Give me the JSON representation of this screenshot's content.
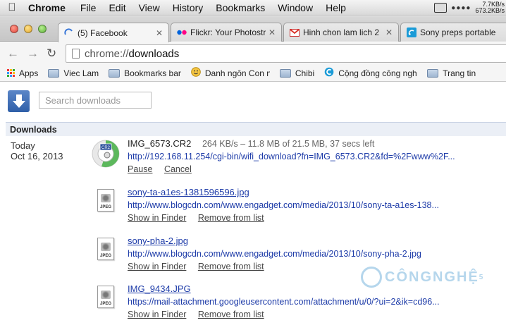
{
  "menubar": {
    "app_name": "Chrome",
    "items": [
      "File",
      "Edit",
      "View",
      "History",
      "Bookmarks",
      "Window",
      "Help"
    ],
    "net_up": "7.7KB/s",
    "net_down": "673.2KB/s"
  },
  "tabs": [
    {
      "label": "(5) Facebook",
      "icon": "loading-spinner-icon"
    },
    {
      "label": "Flickr: Your Photostr",
      "icon": "flickr-icon"
    },
    {
      "label": "Hinh chon lam lich 2",
      "icon": "gmail-icon"
    },
    {
      "label": "Sony preps portable",
      "icon": "engadget-icon"
    }
  ],
  "omnibox": {
    "scheme": "chrome://",
    "host": "downloads"
  },
  "bookmarks": [
    {
      "label": "Apps",
      "icon": "apps-grid-icon"
    },
    {
      "label": "Viec Lam",
      "icon": "folder-icon"
    },
    {
      "label": "Bookmarks bar",
      "icon": "folder-icon"
    },
    {
      "label": "Danh ngôn Con người",
      "icon": "smiley-icon"
    },
    {
      "label": "Chibi",
      "icon": "folder-icon"
    },
    {
      "label": "Cộng đồng công nghệ",
      "icon": "site-c-icon"
    },
    {
      "label": "Trang tin",
      "icon": "folder-icon"
    }
  ],
  "search": {
    "placeholder": "Search downloads"
  },
  "section_title": "Downloads",
  "date_group": {
    "day": "Today",
    "date": "Oct 16, 2013"
  },
  "downloads": [
    {
      "name": "IMG_6573.CR2",
      "status": "264 KB/s – 11.8 MB of 21.5 MB, 37 secs left",
      "url": "http://192.168.11.254/cgi-bin/wifi_download?fn=IMG_6573.CR2&fd=%2Fwww%2F...",
      "actions": [
        "Pause",
        "Cancel"
      ],
      "badge": "CR2",
      "progress": 0.55
    },
    {
      "name": "sony-ta-a1es-1381596596.jpg",
      "url": "http://www.blogcdn.com/www.engadget.com/media/2013/10/sony-ta-a1es-138...",
      "actions": [
        "Show in Finder",
        "Remove from list"
      ],
      "badge": "JPEG"
    },
    {
      "name": "sony-pha-2.jpg",
      "url": "http://www.blogcdn.com/www.engadget.com/media/2013/10/sony-pha-2.jpg",
      "actions": [
        "Show in Finder",
        "Remove from list"
      ],
      "badge": "JPEG"
    },
    {
      "name": "IMG_9434.JPG",
      "url": "https://mail-attachment.googleusercontent.com/attachment/u/0/?ui=2&ik=cd96...",
      "actions": [
        "Show in Finder",
        "Remove from list"
      ],
      "badge": "JPEG"
    }
  ],
  "watermark": {
    "text": "CÔNGNGHỆ",
    "superscript": "5"
  }
}
